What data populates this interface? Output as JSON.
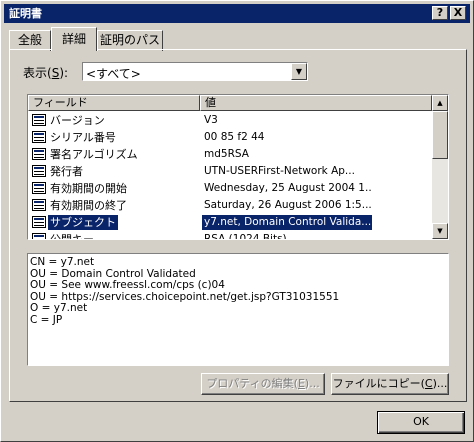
{
  "window": {
    "title": "証明書",
    "help_btn": "?",
    "close_btn": "X"
  },
  "tabs": [
    {
      "label": "全般"
    },
    {
      "label": "詳細"
    },
    {
      "label": "証明のパス"
    }
  ],
  "show": {
    "label_pre": "表示(",
    "label_key": "S",
    "label_post": "):",
    "value": "<すべて>"
  },
  "list": {
    "columns": [
      "フィールド",
      "値"
    ],
    "rows": [
      {
        "field": "バージョン",
        "value": "V3"
      },
      {
        "field": "シリアル番号",
        "value": "00 85 f2 44"
      },
      {
        "field": "署名アルゴリズム",
        "value": "md5RSA"
      },
      {
        "field": "発行者",
        "value": "UTN-USERFirst-Network Ap..."
      },
      {
        "field": "有効期間の開始",
        "value": "Wednesday, 25 August 2004 1..."
      },
      {
        "field": "有効期間の終了",
        "value": "Saturday, 26 August 2006 1:5..."
      },
      {
        "field": "サブジェクト",
        "value": "y7.net, Domain Control Valida..."
      },
      {
        "field": "公開キー",
        "value": "RSA (1024 Bits)"
      }
    ]
  },
  "detail": {
    "lines": [
      "CN = y7.net",
      "OU = Domain Control Validated",
      "OU = See www.freessl.com/cps (c)04",
      "OU = https://services.choicepoint.net/get.jsp?GT31031551",
      "O = y7.net",
      "C = JP"
    ]
  },
  "buttons": {
    "edit_pre": "プロパティの編集(",
    "edit_key": "E",
    "edit_post": ")...",
    "copy_pre": "ファイルにコピー(",
    "copy_key": "C",
    "copy_post": ")...",
    "ok": "OK"
  }
}
